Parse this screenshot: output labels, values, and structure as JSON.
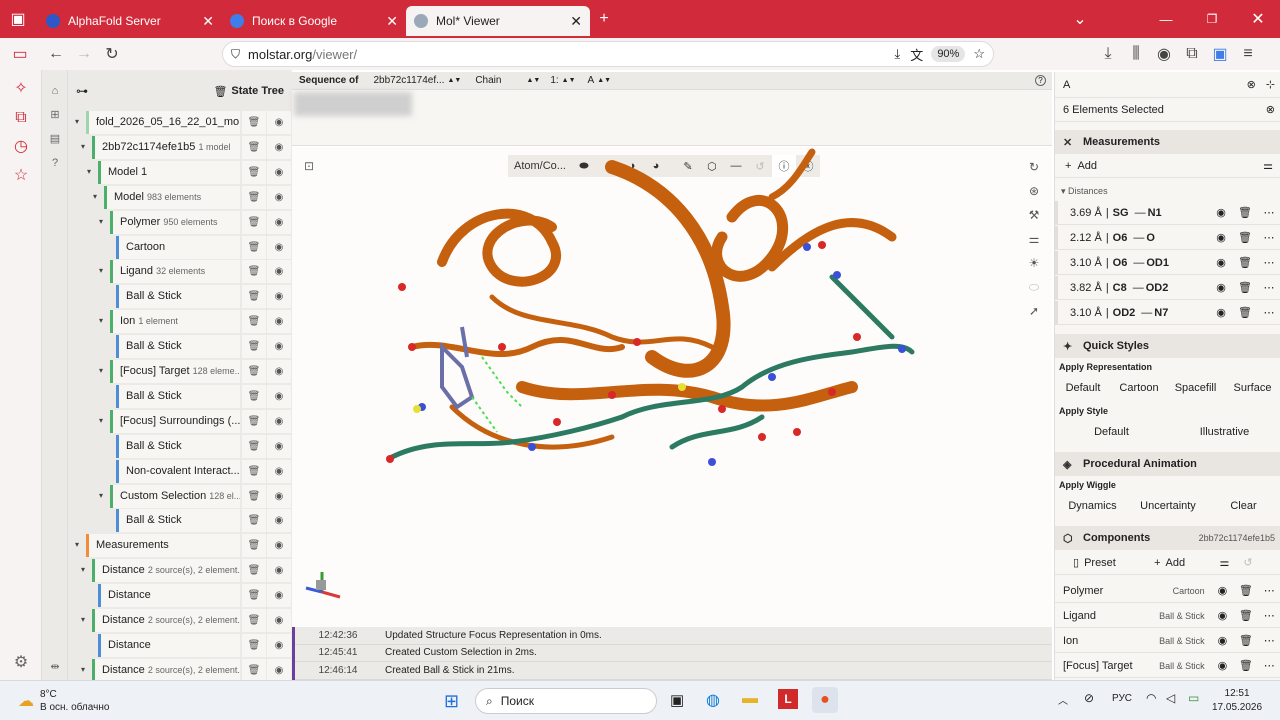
{
  "browser": {
    "tabs": [
      {
        "label": "AlphaFold Server",
        "active": false,
        "color": "#2d58c6"
      },
      {
        "label": "Поиск в Google",
        "active": false,
        "color": "#3f7ee8"
      },
      {
        "label": "Mol* Viewer",
        "active": true,
        "color": "#9aa8b8"
      }
    ],
    "url_host": "molstar.org",
    "url_path": "/viewer/",
    "zoom": "90%"
  },
  "tree": {
    "title": "State Tree",
    "rows": [
      {
        "label": "fold_2026_05_16_22_01_mo...",
        "sub": "",
        "depth": 0,
        "color": "#9fd4ae"
      },
      {
        "label": "2bb72c1174efe1b5",
        "sub": "1 model",
        "depth": 1,
        "color": "#4db06a"
      },
      {
        "label": "Model 1",
        "sub": "",
        "depth": 2,
        "color": "#4db06a"
      },
      {
        "label": "Model",
        "sub": "983 elements",
        "depth": 3,
        "color": "#4db06a"
      },
      {
        "label": "Polymer",
        "sub": "950 elements",
        "depth": 4,
        "color": "#4db06a"
      },
      {
        "label": "Cartoon",
        "sub": "",
        "depth": 5,
        "color": "#4d8ed6"
      },
      {
        "label": "Ligand",
        "sub": "32 elements",
        "depth": 4,
        "color": "#4db06a"
      },
      {
        "label": "Ball & Stick",
        "sub": "",
        "depth": 5,
        "color": "#4d8ed6"
      },
      {
        "label": "Ion",
        "sub": "1 element",
        "depth": 4,
        "color": "#4db06a"
      },
      {
        "label": "Ball & Stick",
        "sub": "",
        "depth": 5,
        "color": "#4d8ed6"
      },
      {
        "label": "[Focus] Target",
        "sub": "128 eleme...",
        "depth": 4,
        "color": "#4db06a"
      },
      {
        "label": "Ball & Stick",
        "sub": "",
        "depth": 5,
        "color": "#4d8ed6"
      },
      {
        "label": "[Focus] Surroundings (...",
        "sub": "",
        "depth": 4,
        "color": "#4db06a"
      },
      {
        "label": "Ball & Stick",
        "sub": "",
        "depth": 5,
        "color": "#4d8ed6"
      },
      {
        "label": "Non-covalent Interact...",
        "sub": "",
        "depth": 5,
        "color": "#4d8ed6"
      },
      {
        "label": "Custom Selection",
        "sub": "128 el...",
        "depth": 4,
        "color": "#4db06a"
      },
      {
        "label": "Ball & Stick",
        "sub": "",
        "depth": 5,
        "color": "#4d8ed6"
      },
      {
        "label": "Measurements",
        "sub": "",
        "depth": 0,
        "color": "#f08c3a"
      },
      {
        "label": "Distance",
        "sub": "2 source(s), 2 element...",
        "depth": 1,
        "color": "#4db06a"
      },
      {
        "label": "Distance",
        "sub": "",
        "depth": 2,
        "color": "#4d8ed6"
      },
      {
        "label": "Distance",
        "sub": "2 source(s), 2 element...",
        "depth": 1,
        "color": "#4db06a"
      },
      {
        "label": "Distance",
        "sub": "",
        "depth": 2,
        "color": "#4d8ed6"
      },
      {
        "label": "Distance",
        "sub": "2 source(s), 2 element...",
        "depth": 1,
        "color": "#4db06a"
      }
    ]
  },
  "seq": {
    "label": "Sequence of",
    "entity": "2bb72c1174ef...",
    "chain": "Chain",
    "one": "1:",
    "a": "A"
  },
  "viewport": {
    "mode": "Atom/Co..."
  },
  "log": [
    {
      "time": "12:42:36",
      "msg": "Updated Structure Focus Representation in 0ms."
    },
    {
      "time": "12:45:41",
      "msg": "Created Custom Selection in 2ms."
    },
    {
      "time": "12:46:14",
      "msg": "Created Ball & Stick in 21ms."
    }
  ],
  "right": {
    "search": "A",
    "selected": "6 Elements Selected",
    "measurements": {
      "title": "Measurements",
      "add": "Add",
      "distances_label": "Distances",
      "rows": [
        {
          "value": "3.69 Å",
          "a": "SG",
          "b": "N1"
        },
        {
          "value": "2.12 Å",
          "a": "O6",
          "b": "O"
        },
        {
          "value": "3.10 Å",
          "a": "O6",
          "b": "OD1"
        },
        {
          "value": "3.82 Å",
          "a": "C8",
          "b": "OD2"
        },
        {
          "value": "3.10 Å",
          "a": "OD2",
          "b": "N7"
        }
      ]
    },
    "quick": {
      "title": "Quick Styles",
      "rep_label": "Apply Representation",
      "reps": [
        "Default",
        "Cartoon",
        "Spacefill",
        "Surface"
      ],
      "style_label": "Apply Style",
      "styles": [
        "Default",
        "Illustrative"
      ]
    },
    "anim": {
      "title": "Procedural Animation",
      "wiggle_label": "Apply Wiggle",
      "wiggles": [
        "Dynamics",
        "Uncertainty",
        "Clear"
      ]
    },
    "components": {
      "title": "Components",
      "id": "2bb72c1174efe1b5",
      "preset": "Preset",
      "add": "Add",
      "rows": [
        {
          "name": "Polymer",
          "rep": "Cartoon"
        },
        {
          "name": "Ligand",
          "rep": "Ball & Stick"
        },
        {
          "name": "Ion",
          "rep": "Ball & Stick"
        },
        {
          "name": "[Focus] Target",
          "rep": "Ball & Stick"
        }
      ]
    }
  },
  "taskbar": {
    "temp": "8°C",
    "weather": "В осн. облачно",
    "search": "Поиск",
    "lang": "РУС",
    "time": "12:51",
    "date": "17.05.2026"
  }
}
